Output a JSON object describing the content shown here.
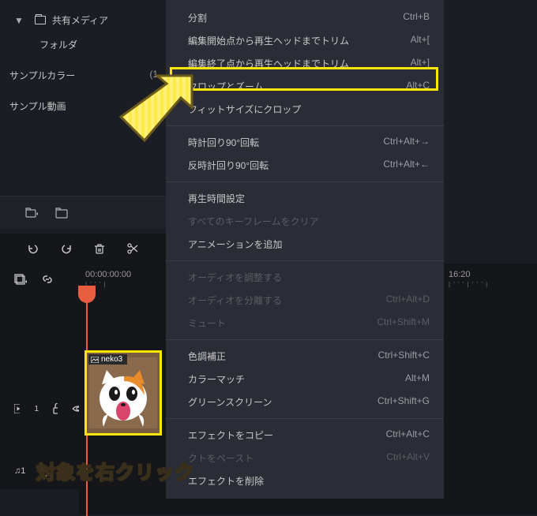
{
  "sidebar": {
    "shared_media_label": "共有メディア",
    "folder_label": "フォルダ",
    "sample_color_label": "サンプルカラー",
    "sample_color_count": "(1",
    "sample_video_label": "サンプル動画"
  },
  "context_menu": {
    "split": {
      "label": "分割",
      "shortcut": "Ctrl+B"
    },
    "trim_start": {
      "label": "編集開始点から再生ヘッドまでトリム",
      "shortcut": "Alt+["
    },
    "trim_end": {
      "label": "編集終了点から再生ヘッドまでトリム",
      "shortcut": "Alt+]"
    },
    "crop_zoom": {
      "label": "クロップとズーム",
      "shortcut": "Alt+C"
    },
    "fit_crop": {
      "label": "フィットサイズにクロップ",
      "shortcut": ""
    },
    "rotate_cw": {
      "label": "時計回り90°回転",
      "shortcut": "Ctrl+Alt+→"
    },
    "rotate_ccw": {
      "label": "反時計回り90°回転",
      "shortcut": "Ctrl+Alt+←"
    },
    "duration": {
      "label": "再生時間設定",
      "shortcut": ""
    },
    "clear_kf": {
      "label": "すべてのキーフレームをクリア",
      "shortcut": ""
    },
    "add_anim": {
      "label": "アニメーションを追加",
      "shortcut": ""
    },
    "adjust_audio": {
      "label": "オーディオを調整する",
      "shortcut": ""
    },
    "detach_audio": {
      "label": "オーディオを分離する",
      "shortcut": "Ctrl+Alt+D"
    },
    "mute": {
      "label": "ミュート",
      "shortcut": "Ctrl+Shift+M"
    },
    "color_correct": {
      "label": "色調補正",
      "shortcut": "Ctrl+Shift+C"
    },
    "color_match": {
      "label": "カラーマッチ",
      "shortcut": "Alt+M"
    },
    "green_screen": {
      "label": "グリーンスクリーン",
      "shortcut": "Ctrl+Shift+G"
    },
    "copy_fx": {
      "label": "エフェクトをコピー",
      "shortcut": "Ctrl+Alt+C"
    },
    "paste_fx": {
      "label": "クトをペースト",
      "shortcut": "Ctrl+Alt+V"
    },
    "delete_fx": {
      "label": "エフェクトを削除",
      "shortcut": ""
    }
  },
  "timeline": {
    "time_start": "00:00:00:00",
    "time_end": "16:20",
    "clip_name": "neko3"
  },
  "annotation": {
    "text": "対象を右クリック"
  }
}
